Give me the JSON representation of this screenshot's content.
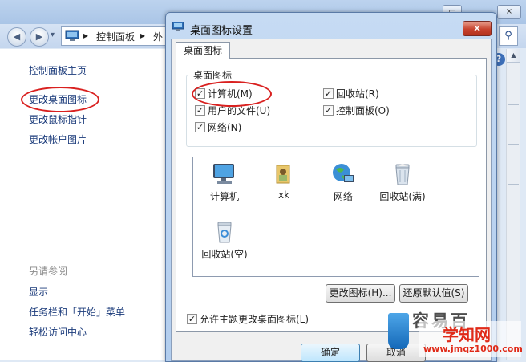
{
  "background_window": {
    "window_controls": [
      "▭",
      "×"
    ],
    "nav": {
      "back": "◀",
      "forward": "▶",
      "dropdown": "▾"
    },
    "address": {
      "separator": "▸",
      "crumb1": "控制面板",
      "crumb2": "外"
    },
    "left_pane": {
      "home": "控制面板主页",
      "items": [
        "更改桌面图标",
        "更改鼠标指针",
        "更改帐户图片"
      ],
      "see_also": "另请参阅",
      "see_also_items": [
        "显示",
        "任务栏和「开始」菜单",
        "轻松访问中心"
      ]
    }
  },
  "dialog": {
    "title": "桌面图标设置",
    "close": "×",
    "tab": "桌面图标",
    "group_label": "桌面图标",
    "checkboxes": [
      {
        "label": "计算机(M)",
        "checked": true
      },
      {
        "label": "回收站(R)",
        "checked": true
      },
      {
        "label": "用户的文件(U)",
        "checked": true
      },
      {
        "label": "控制面板(O)",
        "checked": true
      },
      {
        "label": "网络(N)",
        "checked": true
      }
    ],
    "check_glyph": "✓",
    "icons": [
      {
        "label": "计算机",
        "icon": "computer-icon"
      },
      {
        "label": "xk",
        "icon": "user-folder-icon"
      },
      {
        "label": "网络",
        "icon": "network-icon"
      },
      {
        "label": "回收站(满)",
        "icon": "recycle-bin-full-icon"
      },
      {
        "label": "回收站(空)",
        "icon": "recycle-bin-empty-icon"
      }
    ],
    "change_icon_button": "更改图标(H)...",
    "restore_default_button": "还原默认值(S)",
    "allow_themes": {
      "label": "允许主题更改桌面图标(L)",
      "checked": true
    },
    "ok_button": "确定",
    "cancel_button": "取消"
  },
  "watermark": {
    "ghost_text": "容易百",
    "title": "学知网",
    "url": "www.jmqz1000.com"
  },
  "colors": {
    "accent": "#3c7fb1",
    "highlight": "#d9201f",
    "link": "#1a3a7a"
  }
}
